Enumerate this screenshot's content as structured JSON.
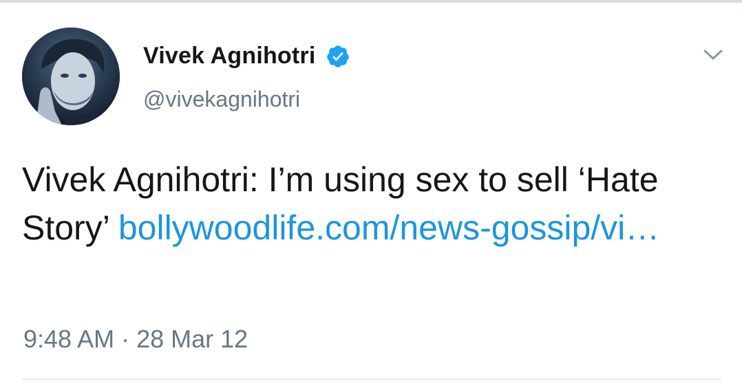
{
  "author": {
    "display_name": "Vivek Agnihotri",
    "handle": "@vivekagnihotri",
    "verified": true,
    "avatar_icon": "profile-photo"
  },
  "tweet": {
    "text": "Vivek Agnihotri: I’m using sex to sell ‘Hate Story’ ",
    "link_text": "bollywoodlife.com/news-gossip/vi…",
    "timestamp": "9:48 AM · 28 Mar 12"
  },
  "icons": {
    "verified": "verified-badge-icon",
    "menu": "chevron-down-icon"
  },
  "colors": {
    "link": "#1b95e0",
    "verified": "#1da1f2",
    "secondary_text": "#657786",
    "primary_text": "#14171a"
  }
}
